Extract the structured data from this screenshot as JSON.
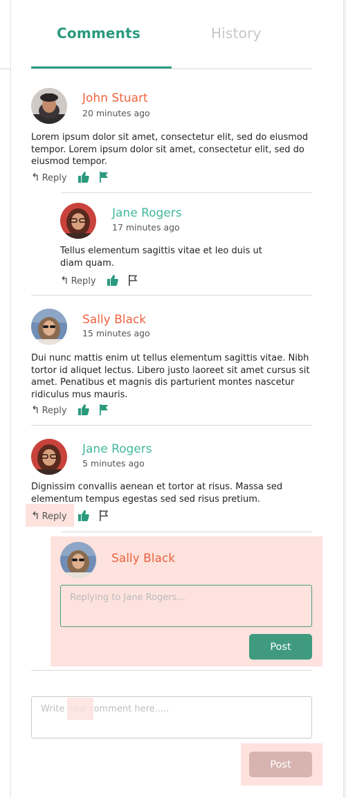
{
  "tabs": {
    "comments": "Comments",
    "history": "History"
  },
  "colors": {
    "accent": "#2a9a7e",
    "name_red": "#f0623f",
    "name_teal": "#3fb89a",
    "highlight": "#fde2de",
    "post_button": "#3f9a7e",
    "post_disabled": "#d7b4b0"
  },
  "comments": [
    {
      "name": "John Stuart",
      "time": "20 minutes ago",
      "text": "Lorem ipsum dolor sit amet, consectetur elit, sed do eiusmod tempor. Lorem ipsum dolor sit amet, consectetur elit, sed do eiusmod tempor.",
      "reply_label": "Reply",
      "flag_filled": true
    },
    {
      "name": "Jane Rogers",
      "time": "17 minutes ago",
      "text": "Tellus elementum sagittis vitae et leo duis ut diam quam.",
      "reply_label": "Reply",
      "flag_filled": false
    },
    {
      "name": "Sally Black",
      "time": "15 minutes ago",
      "text": "Dui nunc mattis enim ut tellus elementum sagittis vitae. Nibh tortor id aliquet lectus. Libero justo laoreet sit amet cursus sit amet. Penatibus et magnis dis parturient montes nascetur ridiculus mus mauris.",
      "reply_label": "Reply",
      "flag_filled": true
    },
    {
      "name": "Jane Rogers",
      "time": "5 minutes ago",
      "text": "Dignissim convallis aenean et tortor at risus. Massa sed elementum tempus egestas sed sed risus pretium.",
      "reply_label": "Reply",
      "flag_filled": false
    }
  ],
  "reply_box": {
    "name": "Sally Black",
    "placeholder": "Replying to Jane Rogers...",
    "post_label": "Post"
  },
  "new_comment": {
    "placeholder": "Write new comment here.....",
    "post_label": "Post"
  }
}
